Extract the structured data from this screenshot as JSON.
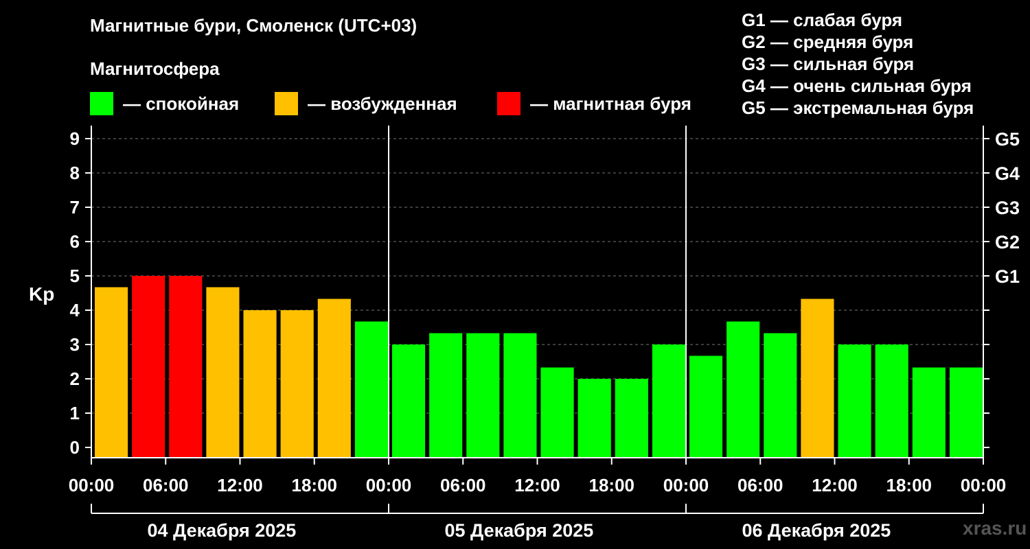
{
  "title": "Магнитные бури, Смоленск (UTC+03)",
  "subtitle": "Магнитосфера",
  "legend": [
    {
      "label": "— спокойная",
      "color": "#00ff00"
    },
    {
      "label": "— возбужденная",
      "color": "#ffc000"
    },
    {
      "label": "— магнитная буря",
      "color": "#ff0000"
    }
  ],
  "g_levels": [
    "G1 — слабая буря",
    "G2 — средняя буря",
    "G3 — сильная буря",
    "G4 — очень сильная буря",
    "G5 — экстремальная буря"
  ],
  "watermark": "xras.ru",
  "chart_data": {
    "type": "bar",
    "ylabel": "Kp",
    "ylim": [
      0,
      9
    ],
    "yticks": [
      "0",
      "1",
      "2",
      "3",
      "4",
      "5",
      "6",
      "7",
      "8",
      "9"
    ],
    "right_ticks": [
      {
        "value": 5,
        "label": "G1"
      },
      {
        "value": 6,
        "label": "G2"
      },
      {
        "value": 7,
        "label": "G3"
      },
      {
        "value": 8,
        "label": "G4"
      },
      {
        "value": 9,
        "label": "G5"
      }
    ],
    "grid": true,
    "xtick_labels": [
      "00:00",
      "06:00",
      "12:00",
      "18:00",
      "00:00",
      "06:00",
      "12:00",
      "18:00",
      "00:00",
      "06:00",
      "12:00",
      "18:00",
      "00:00"
    ],
    "days": [
      "04 Декабря 2025",
      "05 Декабря 2025",
      "06 Декабря 2025"
    ],
    "bin_hours": 3,
    "values": [
      4.67,
      5.0,
      5.0,
      4.67,
      4.0,
      4.0,
      4.33,
      3.67,
      3.0,
      3.33,
      3.33,
      3.33,
      2.33,
      2.0,
      2.0,
      3.0,
      2.67,
      3.67,
      3.33,
      4.33,
      3.0,
      3.0,
      2.33,
      2.33
    ],
    "colors": [
      "#ffc000",
      "#ff0000",
      "#ff0000",
      "#ffc000",
      "#ffc000",
      "#ffc000",
      "#ffc000",
      "#00ff00",
      "#00ff00",
      "#00ff00",
      "#00ff00",
      "#00ff00",
      "#00ff00",
      "#00ff00",
      "#00ff00",
      "#00ff00",
      "#00ff00",
      "#00ff00",
      "#00ff00",
      "#ffc000",
      "#00ff00",
      "#00ff00",
      "#00ff00",
      "#00ff00"
    ]
  }
}
